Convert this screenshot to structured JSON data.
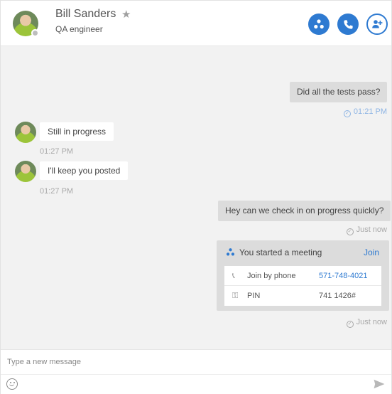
{
  "header": {
    "contact_name": "Bill Sanders",
    "contact_title": "QA engineer",
    "star_glyph": "★",
    "actions": [
      "meeting-icon",
      "phone-icon",
      "add-person-icon"
    ]
  },
  "messages": [
    {
      "direction": "out",
      "text": "Did all the tests pass?",
      "time": "01:21 PM"
    },
    {
      "direction": "in",
      "text": "Still in progress",
      "time": "01:27 PM"
    },
    {
      "direction": "in",
      "text": "I'll keep you posted",
      "time": "01:27 PM"
    },
    {
      "direction": "out",
      "text": "Hey can we check in on progress quickly?",
      "time": "Just now"
    }
  ],
  "meeting": {
    "title": "You started a meeting",
    "join_label": "Join",
    "phone_label": "Join by phone",
    "phone_number": "571-748-4021",
    "pin_label": "PIN",
    "pin_value": "741 1426#",
    "time": "Just now"
  },
  "composer": {
    "placeholder": "Type a new message"
  },
  "colors": {
    "accent": "#2e7ad1",
    "outgoing_bubble": "#dcdcdc",
    "background": "#f2f2f2"
  }
}
